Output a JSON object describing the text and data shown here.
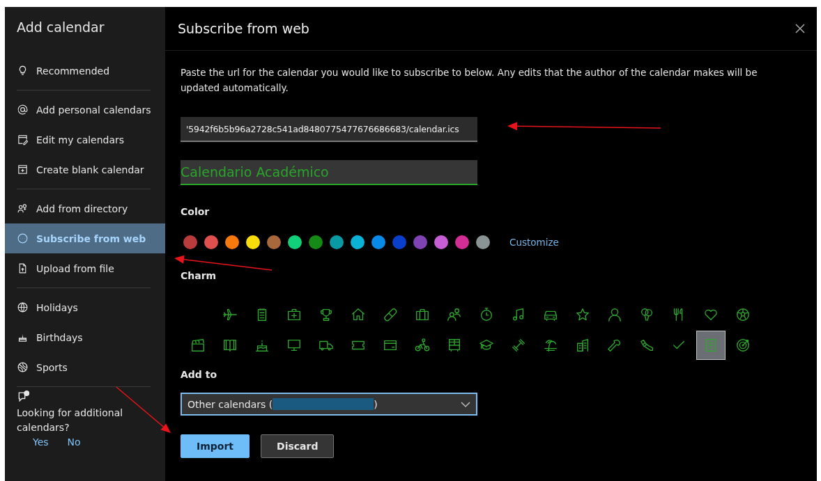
{
  "sidebar": {
    "title": "Add calendar",
    "groups": [
      {
        "items": [
          {
            "label": "Recommended",
            "selected": false
          }
        ]
      },
      {
        "items": [
          {
            "label": "Add personal calendars",
            "selected": false
          },
          {
            "label": "Edit my calendars",
            "selected": false
          },
          {
            "label": "Create blank calendar",
            "selected": false
          }
        ]
      },
      {
        "items": [
          {
            "label": "Add from directory",
            "selected": false
          },
          {
            "label": "Subscribe from web",
            "selected": true
          },
          {
            "label": "Upload from file",
            "selected": false
          }
        ]
      },
      {
        "items": [
          {
            "label": "Holidays",
            "selected": false
          },
          {
            "label": "Birthdays",
            "selected": false
          },
          {
            "label": "Sports",
            "selected": false
          }
        ]
      }
    ],
    "feedback": {
      "question": "Looking for additional calendars?",
      "yes": "Yes",
      "no": "No"
    }
  },
  "panel": {
    "title": "Subscribe from web",
    "description": "Paste the url for the calendar you would like to subscribe to below. Any edits that the author of the calendar makes will be updated automatically.",
    "url_field": {
      "value": "'5942f6b5b96a2728c541ad8480775477676686683/calendar.ics"
    },
    "name_field": {
      "value": "Calendario Académico"
    },
    "color_label": "Color",
    "colors": [
      {
        "color": "#b83c3c"
      },
      {
        "color": "#e0504f"
      },
      {
        "color": "#f7780c"
      },
      {
        "color": "#f9dc0c"
      },
      {
        "color": "#a8683c"
      },
      {
        "color": "#12cf7a"
      },
      {
        "color": "#168a16"
      },
      {
        "color": "#0a9aa4"
      },
      {
        "color": "#0cb2d6"
      },
      {
        "color": "#0a8ae8"
      },
      {
        "color": "#0a3fcc"
      },
      {
        "color": "#7f43b4"
      },
      {
        "color": "#c85ed6"
      },
      {
        "color": "#d32d96"
      },
      {
        "color": "#8a9494"
      }
    ],
    "customize": "Customize",
    "charm_label": "Charm",
    "charms": [
      {
        "selected": false
      },
      {
        "selected": false
      },
      {
        "selected": false
      },
      {
        "selected": false
      },
      {
        "selected": false
      },
      {
        "selected": false
      },
      {
        "selected": false
      },
      {
        "selected": false
      },
      {
        "selected": false
      },
      {
        "selected": false
      },
      {
        "selected": false
      },
      {
        "selected": false
      },
      {
        "selected": false
      },
      {
        "selected": false
      },
      {
        "selected": false
      },
      {
        "selected": false
      },
      {
        "selected": false
      },
      {
        "selected": false
      },
      {
        "selected": false
      },
      {
        "selected": false
      },
      {
        "selected": false
      },
      {
        "selected": false
      },
      {
        "selected": false
      },
      {
        "selected": false
      },
      {
        "selected": false
      },
      {
        "selected": false
      },
      {
        "selected": false
      },
      {
        "selected": false
      },
      {
        "selected": false
      },
      {
        "selected": false
      },
      {
        "selected": false
      },
      {
        "selected": false
      },
      {
        "selected": false
      },
      {
        "selected": true
      },
      {
        "selected": false
      }
    ],
    "add_to_label": "Add to",
    "add_to": {
      "value_start": "Other calendars (",
      "value_end": ")"
    },
    "buttons": [
      {
        "label": "Import",
        "kind": "primary"
      },
      {
        "label": "Discard",
        "kind": "secondary"
      }
    ]
  }
}
